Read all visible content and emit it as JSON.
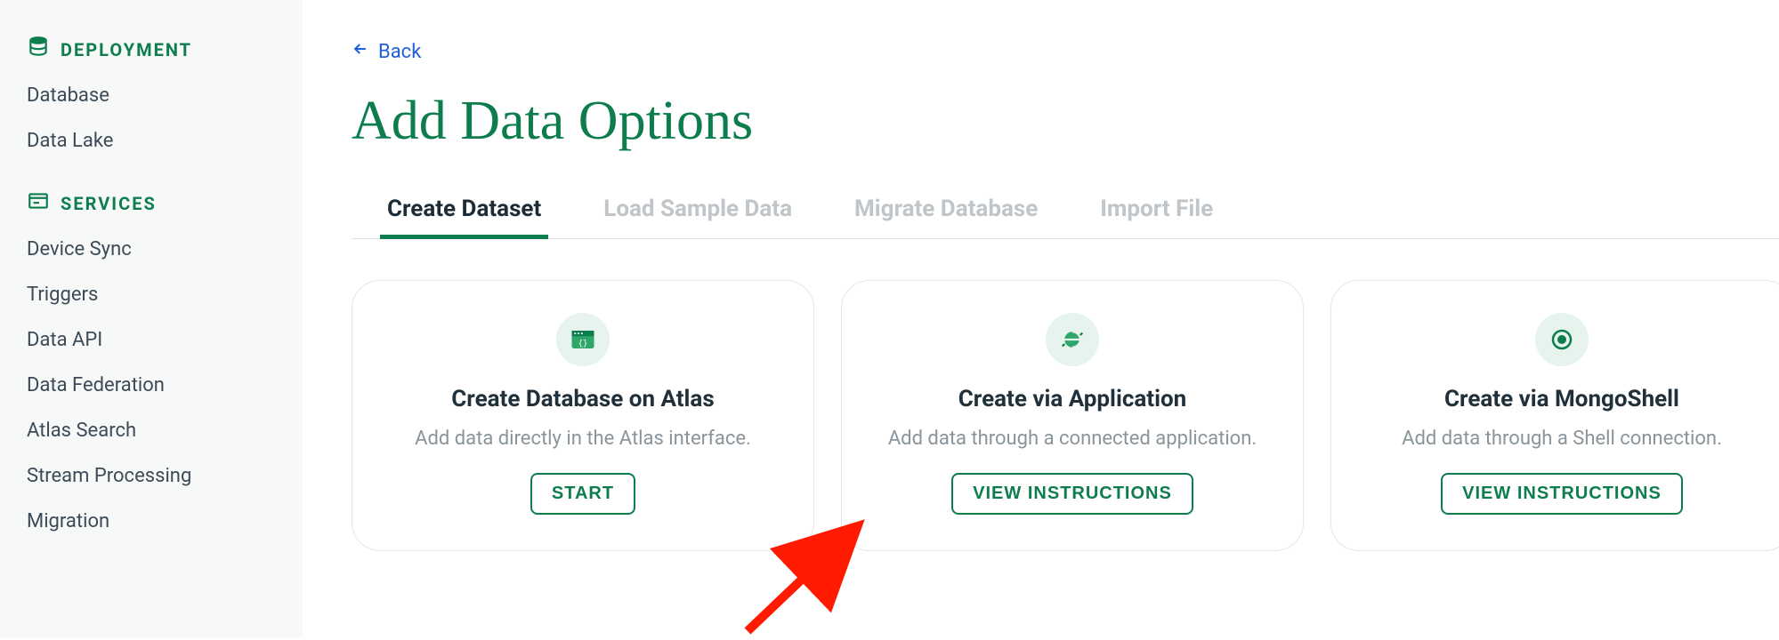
{
  "sidebar": {
    "sections": [
      {
        "label": "DEPLOYMENT",
        "icon": "database-stack-icon",
        "items": [
          "Database",
          "Data Lake"
        ]
      },
      {
        "label": "SERVICES",
        "icon": "services-icon",
        "items": [
          "Device Sync",
          "Triggers",
          "Data API",
          "Data Federation",
          "Atlas Search",
          "Stream Processing",
          "Migration"
        ]
      }
    ]
  },
  "main": {
    "back_label": "Back",
    "title": "Add Data Options",
    "tabs": [
      {
        "label": "Create Dataset",
        "active": true
      },
      {
        "label": "Load Sample Data",
        "active": false
      },
      {
        "label": "Migrate Database",
        "active": false
      },
      {
        "label": "Import File",
        "active": false
      }
    ],
    "cards": [
      {
        "icon": "browser-code-icon",
        "title": "Create Database on Atlas",
        "desc": "Add data directly in the Atlas interface.",
        "button": "START"
      },
      {
        "icon": "globe-icon",
        "title": "Create via Application",
        "desc": "Add data through a connected application.",
        "button": "VIEW INSTRUCTIONS"
      },
      {
        "icon": "target-icon",
        "title": "Create via MongoShell",
        "desc": "Add data through a Shell connection.",
        "button": "VIEW INSTRUCTIONS"
      }
    ]
  },
  "annotation": {
    "type": "arrow",
    "color": "#ff1a00",
    "points_to": "start-button"
  }
}
